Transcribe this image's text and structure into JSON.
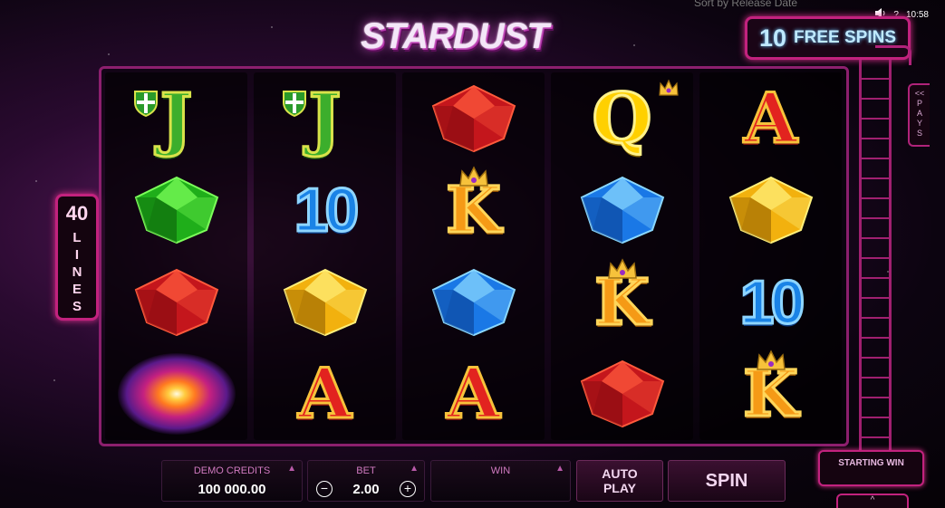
{
  "browser": {
    "sort_label": "Sort by Release Date",
    "time": "10:58",
    "sound_icon": "speaker-icon",
    "help_icon": "question-icon"
  },
  "game": {
    "title": "STARDUST",
    "free_spins": {
      "count": "10",
      "label": "FREE SPINS"
    },
    "lines": {
      "count": "40",
      "letters": [
        "L",
        "I",
        "N",
        "E",
        "S"
      ]
    },
    "pays_tab": {
      "arrows": "<<",
      "letters": [
        "P",
        "A",
        "Y",
        "S"
      ]
    },
    "starting_win_label": "STARTING WIN",
    "reels": [
      [
        "J",
        "green-gem",
        "red-gem",
        "galaxy"
      ],
      [
        "J",
        "10",
        "yellow-gem",
        "A"
      ],
      [
        "red-gem",
        "K",
        "blue-gem",
        "A"
      ],
      [
        "Q",
        "blue-gem",
        "K",
        "red-gem"
      ],
      [
        "A",
        "yellow-gem",
        "10",
        "K"
      ]
    ]
  },
  "controls": {
    "demo_credits_label": "DEMO CREDITS",
    "demo_credits_value": "100 000.00",
    "bet_label": "BET",
    "bet_value": "2.00",
    "bet_minus": "−",
    "bet_plus": "+",
    "win_label": "WIN",
    "win_value": "",
    "auto_play_line1": "AUTO",
    "auto_play_line2": "PLAY",
    "spin_label": "SPIN"
  },
  "colors": {
    "accent": "#c2227e",
    "panel_text": "#d07ac0"
  }
}
